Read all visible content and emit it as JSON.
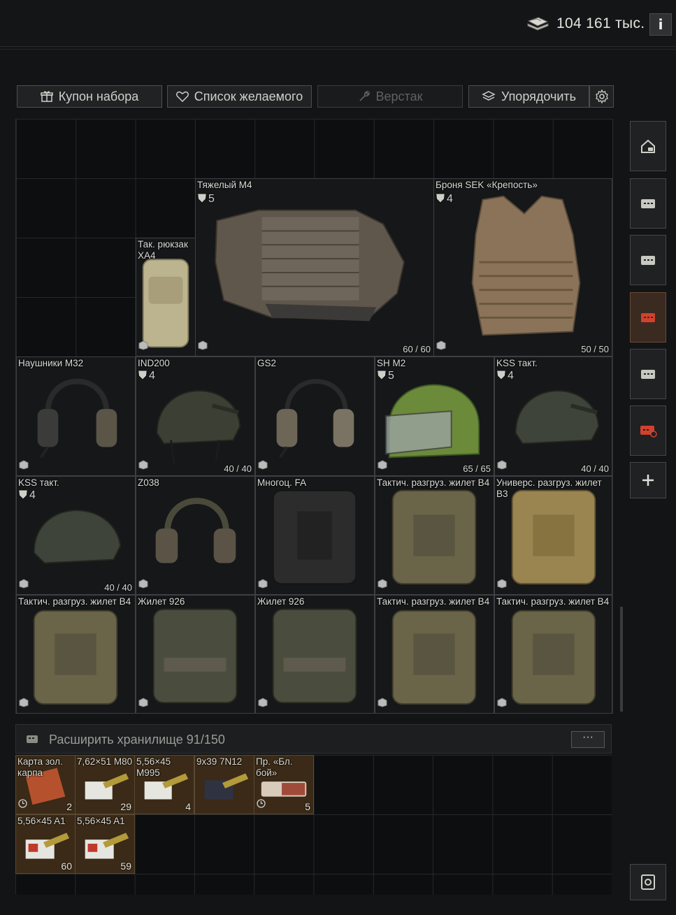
{
  "topbar": {
    "money_text": "104 161 тыс.",
    "info_label": "i"
  },
  "toolbar": {
    "kit_coupon": "Купон набора",
    "wishlist": "Список желаемого",
    "workbench": "Верстак",
    "sort": "Упорядочить"
  },
  "items": [
    {
      "name": "Тяжелый М4",
      "armor": "5",
      "durability": "60 / 60"
    },
    {
      "name": "Броня SEK «Крепость»",
      "armor": "4",
      "durability": "50 / 50"
    },
    {
      "name": "Так. рюкзак ХА4"
    },
    {
      "name": "Наушники М32"
    },
    {
      "name": "IND200",
      "armor": "4",
      "durability": "40 / 40"
    },
    {
      "name": "GS2"
    },
    {
      "name": "SH M2",
      "armor": "5",
      "durability": "65 / 65"
    },
    {
      "name": "KSS такт.",
      "armor": "4",
      "durability": "40 / 40"
    },
    {
      "name": "KSS такт.",
      "armor": "4",
      "durability": "40 / 40"
    },
    {
      "name": "Z038"
    },
    {
      "name": "Многоц. FA"
    },
    {
      "name": "Тактич. разгруз. жилет В4"
    },
    {
      "name": "Универс. разгруз. жилет В3"
    },
    {
      "name": "Тактич. разгруз. жилет В4"
    },
    {
      "name": "Жилет 926"
    },
    {
      "name": "Жилет 926"
    },
    {
      "name": "Тактич. разгруз. жилет В4"
    },
    {
      "name": "Тактич. разгруз. жилет В4"
    }
  ],
  "expand": {
    "label": "Расширить хранилище 91/150",
    "more": "···"
  },
  "ammo": [
    {
      "name": "Карта зол. карпа",
      "count": "2"
    },
    {
      "name": "7,62×51 M80",
      "count": "29"
    },
    {
      "name": "5,56×45 M995",
      "count": "4"
    },
    {
      "name": "9x39 7N12",
      "count": ""
    },
    {
      "name": "Пр. «Бл. бой»",
      "count": "5"
    },
    {
      "name": "5,56×45 A1",
      "count": "60"
    },
    {
      "name": "5,56×45 A1",
      "count": "59"
    }
  ],
  "sidebar": [
    "home-icon",
    "stash-icon",
    "stash-icon",
    "stash-active-icon",
    "stash-icon",
    "stash-locked-icon",
    "add-icon",
    "safe-icon"
  ],
  "colors": {
    "accent_red": "#d2412d",
    "item_border": "#3d4042",
    "ammo_bg": "#3a2a17"
  }
}
